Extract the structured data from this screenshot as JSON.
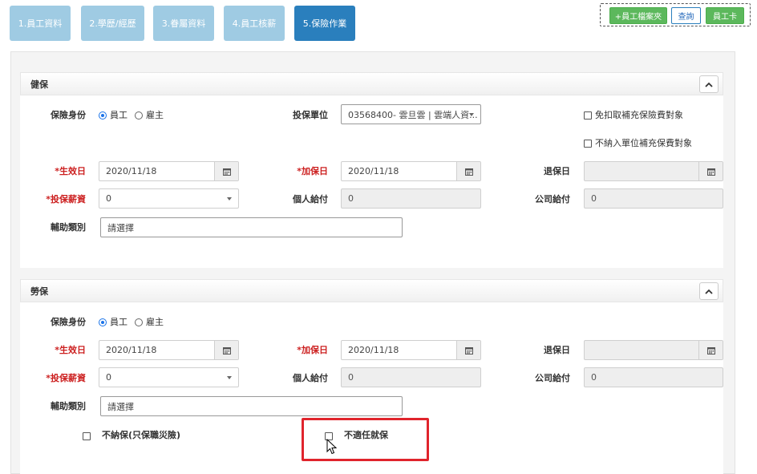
{
  "tabs": [
    {
      "label": "1.員工資料"
    },
    {
      "label": "2.學歷/經歷"
    },
    {
      "label": "3.眷屬資料"
    },
    {
      "label": "4.員工核薪"
    },
    {
      "label": "5.保險作業"
    }
  ],
  "toolbar": {
    "employee_folder": "+員工檔案夾",
    "query": "查詢",
    "employee_card": "員工卡"
  },
  "health": {
    "title": "健保",
    "identity_label": "保險身份",
    "identity_options": [
      "員工",
      "雇主"
    ],
    "unit_label": "投保單位",
    "unit_value": "03568400- 雲旦雲 | 雲端人資...",
    "exempt_label": "免扣取補充保險費對象",
    "exclude_label": "不納入單位補充保費對象",
    "effective_label": "*生效日",
    "effective_value": "2020/11/18",
    "enroll_label": "*加保日",
    "enroll_value": "2020/11/18",
    "withdraw_label": "退保日",
    "withdraw_value": "",
    "salary_label": "*投保薪資",
    "salary_value": "0",
    "personal_label": "個人給付",
    "personal_value": "0",
    "company_label": "公司給付",
    "company_value": "0",
    "subsidy_label": "輔助類別",
    "subsidy_value": "請選擇"
  },
  "labor": {
    "title": "勞保",
    "identity_label": "保險身份",
    "identity_options": [
      "員工",
      "雇主"
    ],
    "effective_label": "*生效日",
    "effective_value": "2020/11/18",
    "enroll_label": "*加保日",
    "enroll_value": "2020/11/18",
    "withdraw_label": "退保日",
    "withdraw_value": "",
    "salary_label": "*投保薪資",
    "salary_value": "0",
    "personal_label": "個人給付",
    "personal_value": "0",
    "company_label": "公司給付",
    "company_value": "0",
    "subsidy_label": "輔助類別",
    "subsidy_value": "請選擇",
    "occupational_only_label": "不納保(只保職災險)",
    "not_employment_label": "不適任就保"
  },
  "icons": {
    "calendar": "calendar-icon",
    "collapse": "chevron-up-icon",
    "cursor": "mouse-pointer-icon"
  },
  "colors": {
    "tab": "#9fcbe3",
    "tab_active": "#2a7fbd",
    "green": "#5cb85c",
    "required": "#cc1f1f",
    "highlight": "#e0242c"
  }
}
